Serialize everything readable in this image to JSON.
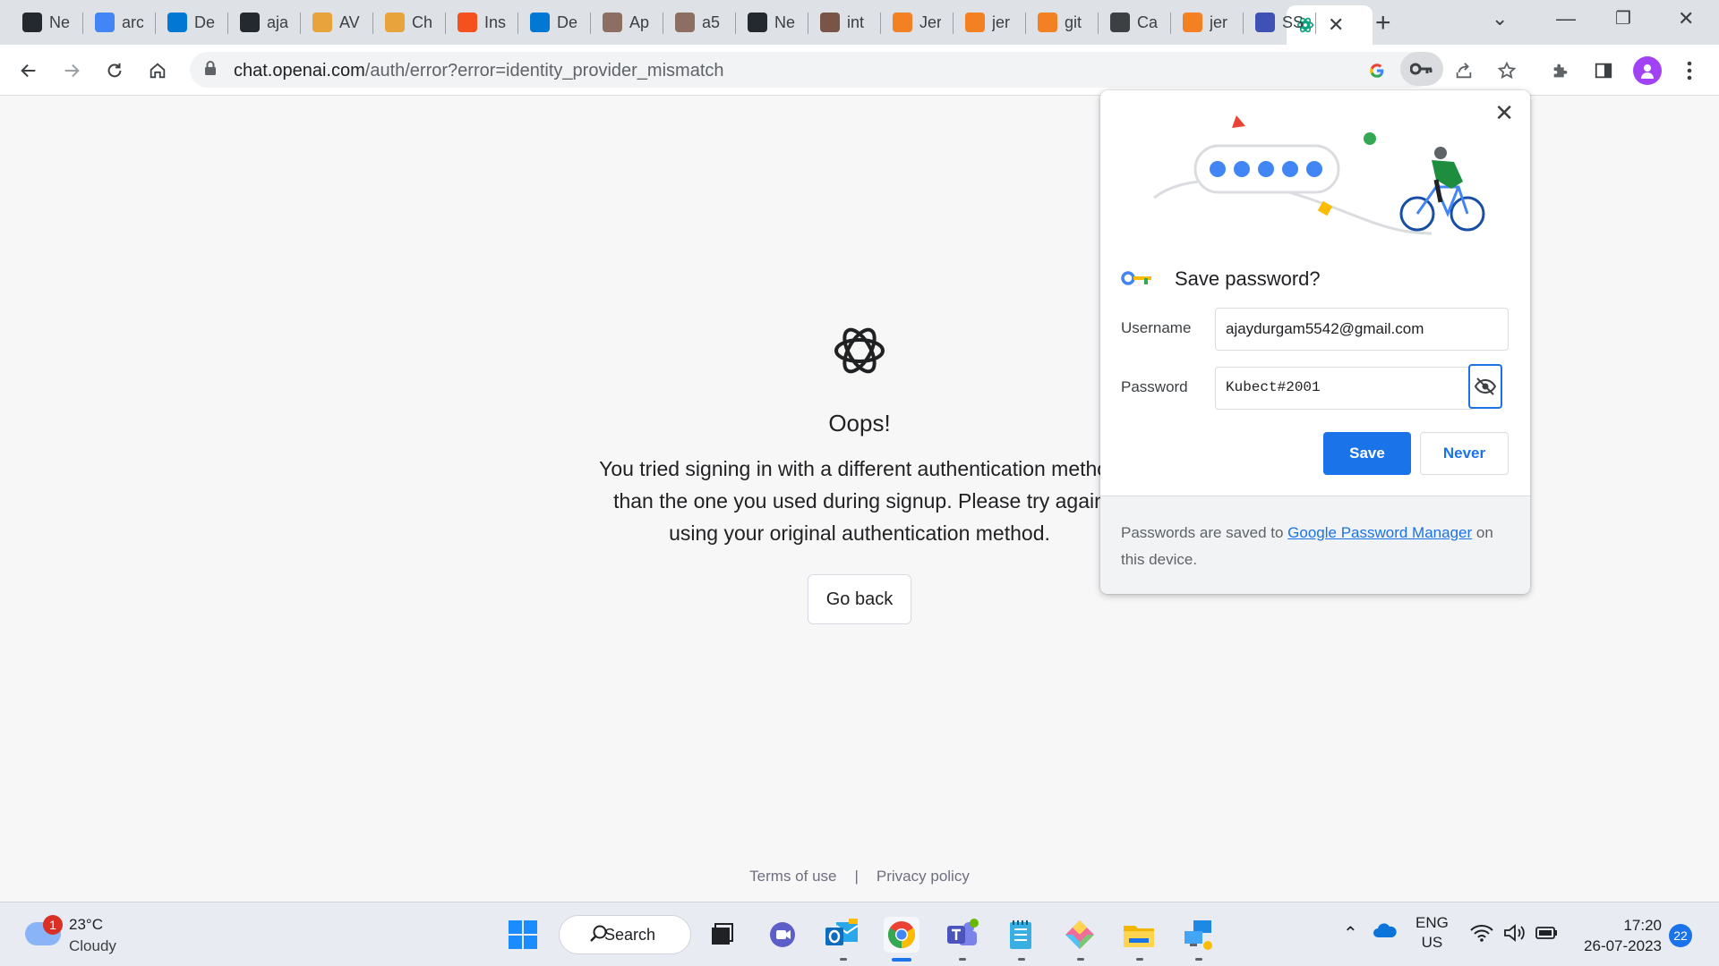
{
  "browser": {
    "tabs": [
      {
        "title": "Ne",
        "icon": "github-icon",
        "color": "#24292f"
      },
      {
        "title": "arc",
        "icon": "google-icon",
        "color": "#4285f4"
      },
      {
        "title": "De",
        "icon": "edge-icon",
        "color": "#0078d4"
      },
      {
        "title": "aja",
        "icon": "github-icon",
        "color": "#24292f"
      },
      {
        "title": "AV",
        "icon": "box-icon",
        "color": "#e8a33d"
      },
      {
        "title": "Ch",
        "icon": "box-icon",
        "color": "#e8a33d"
      },
      {
        "title": "Ins",
        "icon": "copy-icon",
        "color": "#f4511e"
      },
      {
        "title": "De",
        "icon": "edge-icon",
        "color": "#0078d4"
      },
      {
        "title": "Ap",
        "icon": "image-icon",
        "color": "#8d6e63"
      },
      {
        "title": "a5",
        "icon": "image-icon",
        "color": "#8d6e63"
      },
      {
        "title": "Ne",
        "icon": "github-icon",
        "color": "#24292f"
      },
      {
        "title": "int",
        "icon": "person-icon",
        "color": "#795548"
      },
      {
        "title": "Jer",
        "icon": "stack-icon",
        "color": "#f48024"
      },
      {
        "title": "jer",
        "icon": "stack-icon",
        "color": "#f48024"
      },
      {
        "title": "git",
        "icon": "stack-icon",
        "color": "#f48024"
      },
      {
        "title": "Ca",
        "icon": "pen-icon",
        "color": "#3c4043"
      },
      {
        "title": "jer",
        "icon": "stack-icon",
        "color": "#f48024"
      },
      {
        "title": "SS",
        "icon": "uil-icon",
        "color": "#3f51b5"
      }
    ],
    "active_tab_icon": "openai-icon",
    "url_host": "chat.openai.com",
    "url_path": "/auth/error?error=identity_provider_mismatch"
  },
  "page": {
    "heading": "Oops!",
    "message": "You tried signing in with a different authentication method than the one you used during signup. Please try again using your original authentication method.",
    "go_back_label": "Go back",
    "footer": {
      "terms": "Terms of use",
      "separator": "|",
      "privacy": "Privacy policy"
    }
  },
  "password_popup": {
    "title": "Save password?",
    "username_label": "Username",
    "username_value": "ajaydurgam5542@gmail.com",
    "password_label": "Password",
    "password_value": "Kubect#2001",
    "save_label": "Save",
    "never_label": "Never",
    "footer_prefix": "Passwords are saved to",
    "footer_link": "Google Password Manager",
    "footer_suffix": "on this device."
  },
  "taskbar": {
    "weather_temp": "23°C",
    "weather_condition": "Cloudy",
    "weather_badge": "1",
    "search_label": "Search",
    "lang_top": "ENG",
    "lang_bottom": "US",
    "time": "17:20",
    "date": "26-07-2023",
    "notification_count": "22"
  },
  "colors": {
    "accent": "#1a73e8",
    "page_background": "#f7f7f8",
    "tabstrip": "#dee1e6"
  }
}
